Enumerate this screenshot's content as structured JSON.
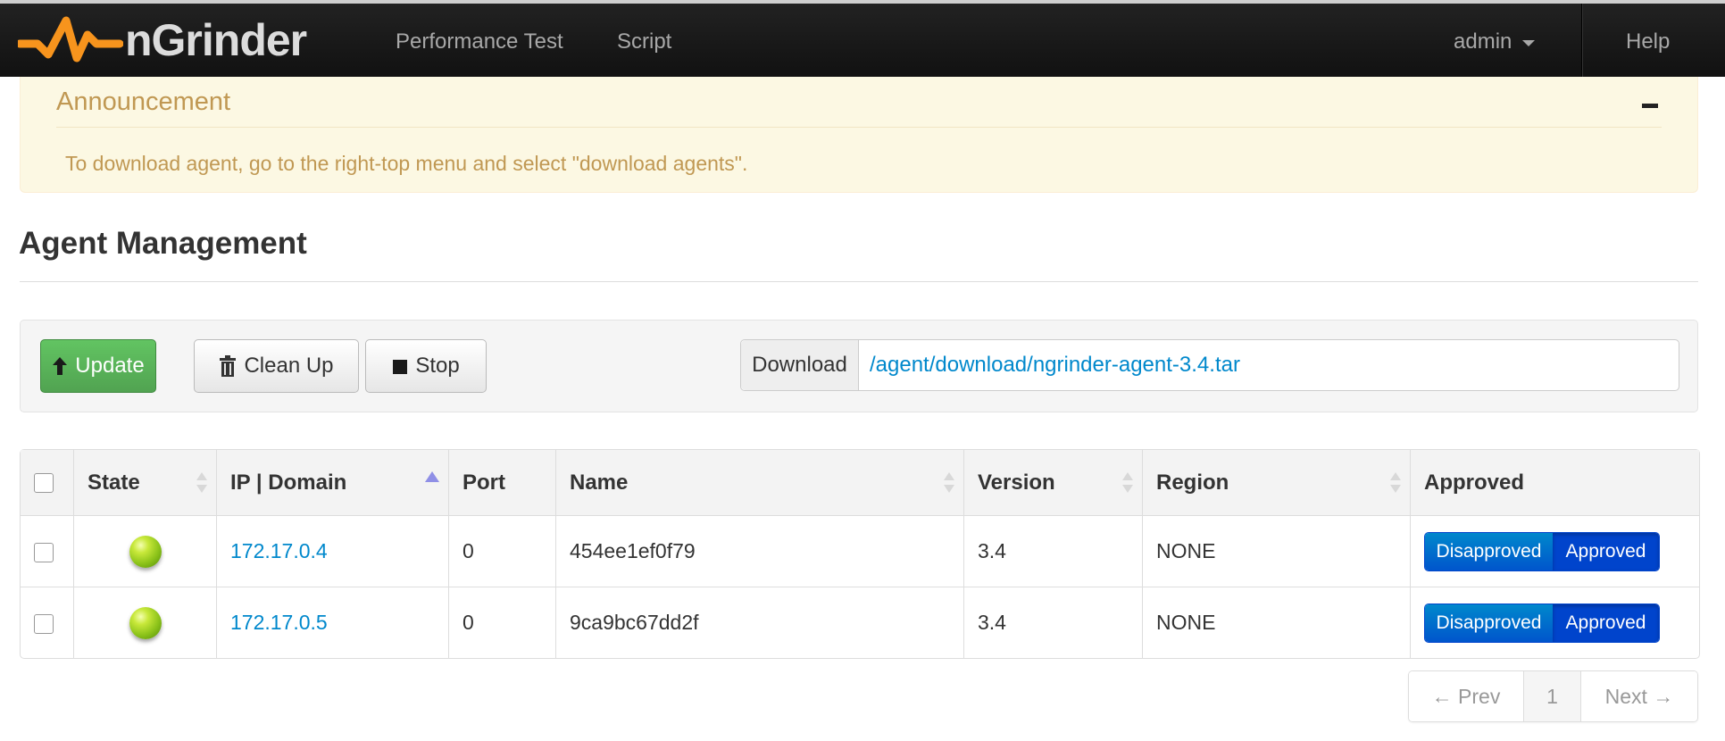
{
  "navbar": {
    "brand": "nGrinder",
    "links": {
      "performance_test": "Performance Test",
      "script": "Script"
    },
    "user_menu": "admin",
    "help": "Help"
  },
  "announcement": {
    "title": "Announcement",
    "message": "To download agent, go to the right-top menu and select \"download agents\"."
  },
  "page": {
    "title": "Agent Management"
  },
  "toolbar": {
    "update_label": "Update",
    "cleanup_label": "Clean Up",
    "stop_label": "Stop",
    "download_label": "Download",
    "download_path": "/agent/download/ngrinder-agent-3.4.tar"
  },
  "table": {
    "headers": [
      "State",
      "IP | Domain",
      "Port",
      "Name",
      "Version",
      "Region",
      "Approved"
    ],
    "rows": [
      {
        "state": "green",
        "ip": "172.17.0.4",
        "port": "0",
        "name": "454ee1ef0f79",
        "version": "3.4",
        "region": "NONE",
        "disapproved": "Disapproved",
        "approved": "Approved"
      },
      {
        "state": "green",
        "ip": "172.17.0.5",
        "port": "0",
        "name": "9ca9bc67dd2f",
        "version": "3.4",
        "region": "NONE",
        "disapproved": "Disapproved",
        "approved": "Approved"
      }
    ]
  },
  "pagination": {
    "prev": "← Prev",
    "current": "1",
    "next": "Next →"
  },
  "colors": {
    "accent_link": "#0088cc",
    "update_green": "#51a351",
    "announcement_text": "#c09853",
    "toggle_blue": "#0044cc"
  }
}
